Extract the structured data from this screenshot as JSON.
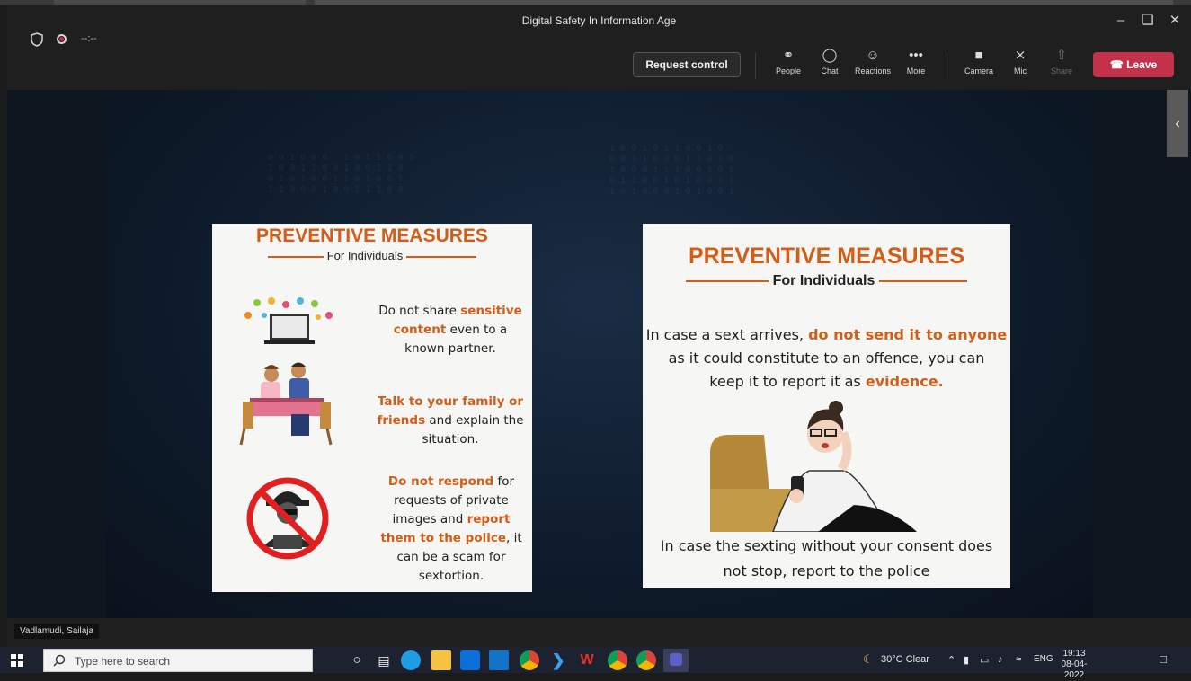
{
  "window": {
    "title": "Digital Safety In Information Age"
  },
  "meeting": {
    "timer": "--:--",
    "request_control_label": "Request control",
    "toolbar": [
      {
        "id": "people",
        "label": "People",
        "icon": "people-icon"
      },
      {
        "id": "chat",
        "label": "Chat",
        "icon": "chat-icon"
      },
      {
        "id": "reactions",
        "label": "Reactions",
        "icon": "reactions-icon"
      },
      {
        "id": "more",
        "label": "More",
        "icon": "more-icon"
      },
      {
        "id": "camera",
        "label": "Camera",
        "icon": "camera-icon"
      },
      {
        "id": "mic",
        "label": "Mic",
        "icon": "mic-muted-icon"
      },
      {
        "id": "share",
        "label": "Share",
        "icon": "share-icon"
      }
    ],
    "leave_label": "Leave",
    "presenter_name": "Vadlamudi, Sailaja",
    "accent_color": "#c4314b"
  },
  "slide_left": {
    "title": "PREVENTIVE MEASURES",
    "subtitle": "For Individuals",
    "items": [
      {
        "pre": "Do not share ",
        "hl": "sensitive content",
        "post": " even to a known partner."
      },
      {
        "pre": "",
        "hl": "Talk to your family or friends",
        "post": " and explain the situation."
      },
      {
        "pre": "",
        "hl": "Do not respond",
        "post": " for requests of private images and ",
        "hl2": "report them to the police",
        "post2": ", it can be a scam for sextortion."
      }
    ]
  },
  "slide_right": {
    "title": "PREVENTIVE MEASURES",
    "subtitle": "For Individuals",
    "p1_pre": "In case a sext arrives, ",
    "p1_hl": "do not send it to anyone",
    "p1_mid": "as it could constitute to an offence, you can",
    "p1_end_pre": "keep it to report it as ",
    "p1_end_hl": "evidence.",
    "p2_line1": "In case the sexting without your consent does",
    "p2_line2": "not stop, report to the police",
    "highlight_color": "#d35d17"
  },
  "taskbar": {
    "search_placeholder": "Type here to search",
    "weather": "30°C  Clear",
    "language": "ENG",
    "time": "19:13",
    "date": "08-04-2022"
  }
}
